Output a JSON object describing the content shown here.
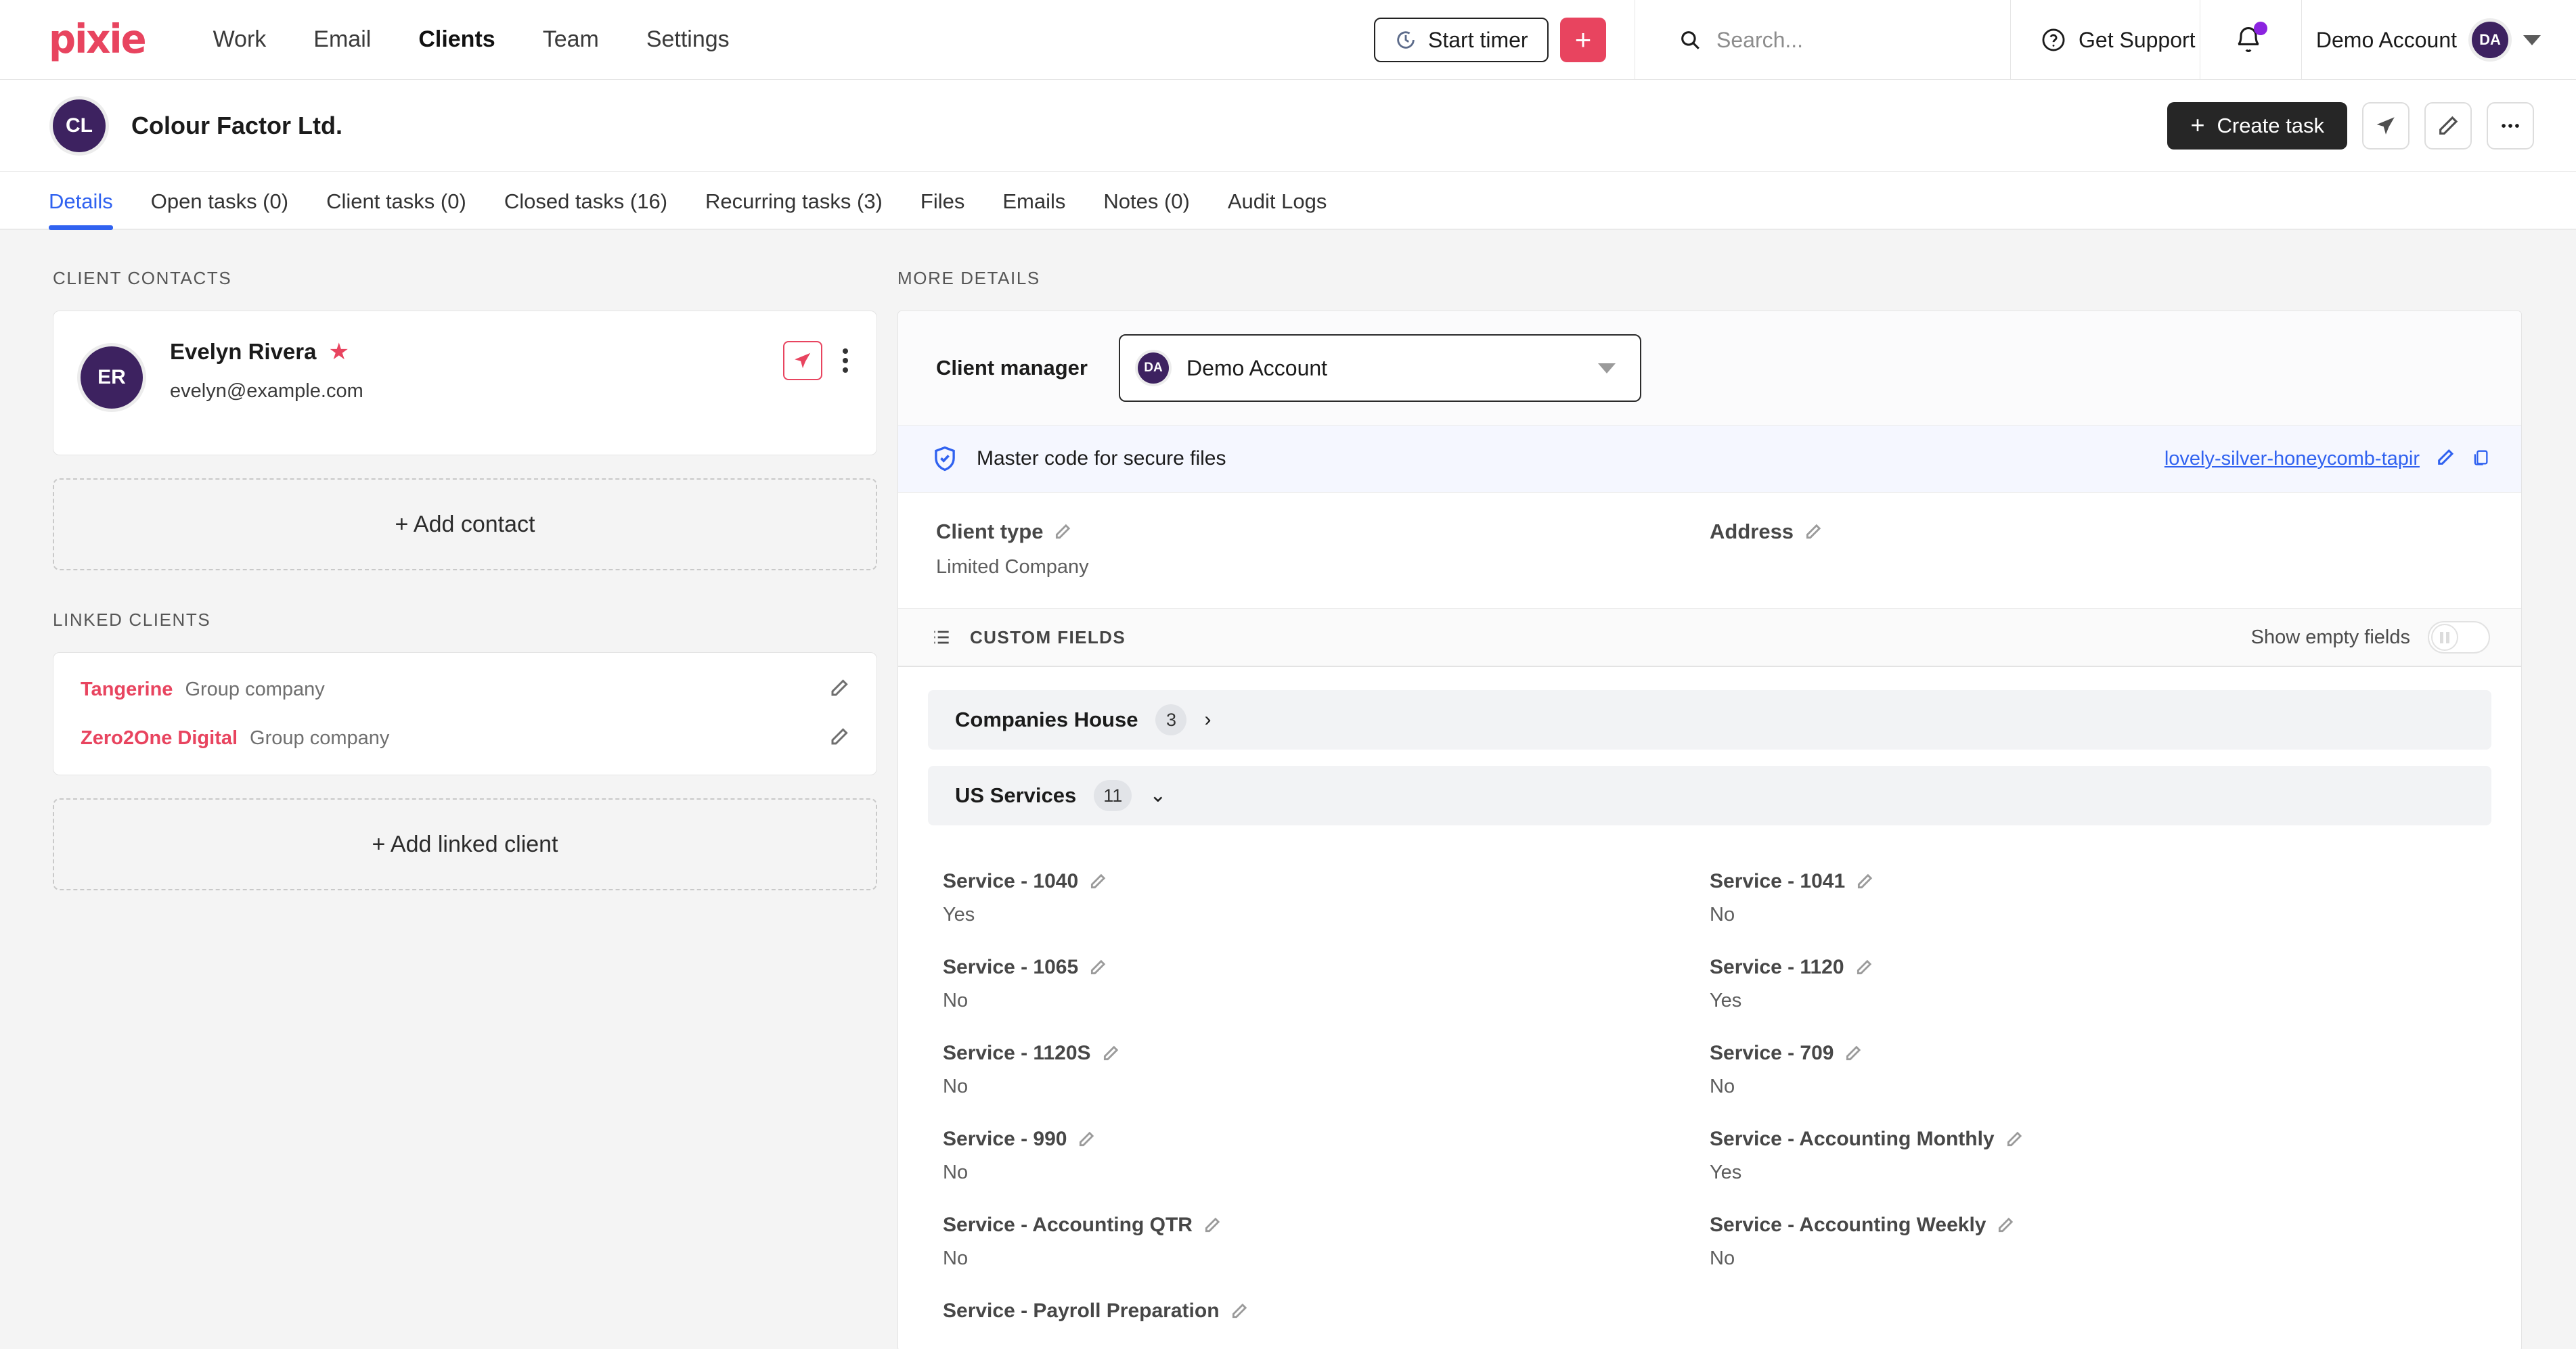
{
  "topnav": {
    "logo": "pixie",
    "links": [
      {
        "label": "Work",
        "active": false
      },
      {
        "label": "Email",
        "active": false
      },
      {
        "label": "Clients",
        "active": true
      },
      {
        "label": "Team",
        "active": false
      },
      {
        "label": "Settings",
        "active": false
      }
    ],
    "start_timer_label": "Start timer",
    "add_button_label": "+",
    "search_placeholder": "Search...",
    "get_support_label": "Get Support",
    "account_name": "Demo Account",
    "account_initials": "DA",
    "icons": {
      "timer": "timer-icon",
      "search": "search-icon",
      "help": "question-circle-icon",
      "bell": "bell-icon",
      "caret": "chevron-down-icon"
    }
  },
  "client_header": {
    "initials": "CL",
    "title": "Colour Factor Ltd.",
    "create_task_label": "Create task",
    "actions": [
      "send-icon",
      "pencil-icon",
      "more-icon"
    ]
  },
  "tabs": [
    {
      "label": "Details",
      "active": true
    },
    {
      "label": "Open tasks (0)",
      "active": false
    },
    {
      "label": "Client tasks (0)",
      "active": false
    },
    {
      "label": "Closed tasks (16)",
      "active": false
    },
    {
      "label": "Recurring tasks (3)",
      "active": false
    },
    {
      "label": "Files",
      "active": false
    },
    {
      "label": "Emails",
      "active": false
    },
    {
      "label": "Notes (0)",
      "active": false
    },
    {
      "label": "Audit Logs",
      "active": false
    }
  ],
  "left": {
    "contacts_label": "CLIENT CONTACTS",
    "contact": {
      "initials": "ER",
      "name": "Evelyn Rivera",
      "starred": true,
      "email": "evelyn@example.com"
    },
    "add_contact_label": "+ Add contact",
    "linked_label": "LINKED CLIENTS",
    "linked_clients": [
      {
        "name": "Tangerine",
        "type": "Group company"
      },
      {
        "name": "Zero2One Digital",
        "type": "Group company"
      }
    ],
    "add_linked_label": "+ Add linked client"
  },
  "right": {
    "more_details_label": "MORE DETAILS",
    "client_manager_label": "Client manager",
    "client_manager_value": "Demo Account",
    "client_manager_initials": "DA",
    "master_code_label": "Master code for secure files",
    "master_code_value": "lovely-silver-honeycomb-tapir",
    "client_type_label": "Client type",
    "client_type_value": "Limited Company",
    "address_label": "Address",
    "address_value": "",
    "custom_fields_label": "CUSTOM FIELDS",
    "show_empty_fields_label": "Show empty fields",
    "show_empty_fields_on": false,
    "groups": [
      {
        "name": "Companies House",
        "count": "3",
        "expanded": false
      },
      {
        "name": "US Services",
        "count": "11",
        "expanded": true
      }
    ],
    "fields": [
      {
        "name": "Service - 1040",
        "value": "Yes"
      },
      {
        "name": "Service - 1041",
        "value": "No"
      },
      {
        "name": "Service - 1065",
        "value": "No"
      },
      {
        "name": "Service - 1120",
        "value": "Yes"
      },
      {
        "name": "Service - 1120S",
        "value": "No"
      },
      {
        "name": "Service - 709",
        "value": "No"
      },
      {
        "name": "Service - 990",
        "value": "No"
      },
      {
        "name": "Service - Accounting Monthly",
        "value": "Yes"
      },
      {
        "name": "Service - Accounting QTR",
        "value": "No"
      },
      {
        "name": "Service - Accounting Weekly",
        "value": "No"
      },
      {
        "name": "Service - Payroll Preparation",
        "value": ""
      }
    ]
  },
  "colors": {
    "brand_red": "#e8445f",
    "accent_blue": "#3062f0",
    "avatar_purple": "#3d2260",
    "dark_button": "#262626",
    "notification_purple": "#8b23e0"
  }
}
